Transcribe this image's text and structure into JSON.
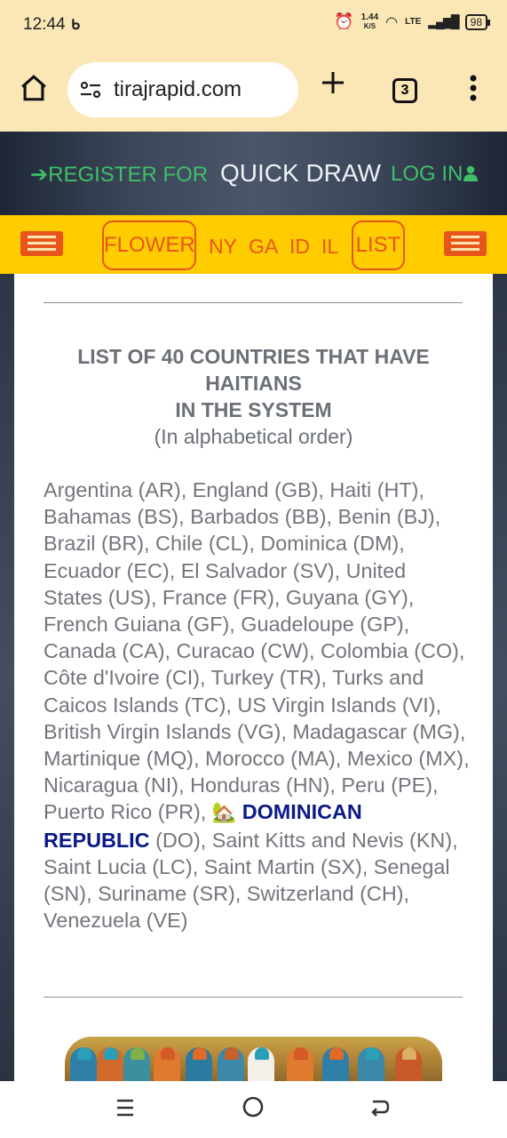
{
  "status": {
    "time": "12:44",
    "speed_value": "1.44",
    "speed_unit": "K/S",
    "network": "LTE",
    "battery": "98"
  },
  "browser": {
    "url": "tirajrapid.com",
    "tab_count": "3"
  },
  "header": {
    "register": "REGISTER FOR",
    "quick_draw": "QUICK DRAW",
    "login": "LOG IN"
  },
  "nav": {
    "flower": "FLOWER",
    "ny": "NY",
    "ga": "GA",
    "id": "ID",
    "il": "IL",
    "list": "LIST"
  },
  "content": {
    "title_line1": "LIST OF 40 COUNTRIES THAT HAVE",
    "title_line2": "HAITIANS",
    "title_line3": "IN THE SYSTEM",
    "subtitle": "(In alphabetical order)",
    "countries_before": "Argentina (AR), England (GB), Haiti (HT), Bahamas (BS), Barbados (BB), Benin (BJ), Brazil (BR), Chile (CL), Dominica (DM), Ecuador (EC), El Salvador (SV), United States (US), France (FR), Guyana (GY), French Guiana (GF), Guadeloupe (GP), Canada (CA), Curacao (CW), Colombia (CO), Côte d'Ivoire (CI), Turkey (TR), Turks and Caicos Islands (TC), US Virgin Islands (VI), British Virgin Islands (VG), Madagascar (MG), Martinique (MQ), Morocco (MA), Mexico (MX), Nicaragua (NI), Honduras (HN), Peru (PE), Puerto Rico (PR),",
    "house_emoji": "🏡",
    "highlight": "DOMINICAN REPUBLIC",
    "countries_after": "(DO), Saint Kitts and Nevis (KN), Saint Lucia (LC), Saint Martin (SX), Senegal (SN), Suriname (SR), Switzerland (CH), Venezuela (VE)"
  },
  "icons": {
    "home": "home-icon",
    "site_info": "tune-icon",
    "new_tab": "plus-icon",
    "menu": "more-vert-icon",
    "login": "user-icon",
    "register": "sign-in-icon"
  },
  "colors": {
    "accent_green": "#3fbf6a",
    "nav_yellow": "#ffcc00",
    "nav_orange": "#e8551c",
    "highlight_blue": "#0b1a87"
  }
}
